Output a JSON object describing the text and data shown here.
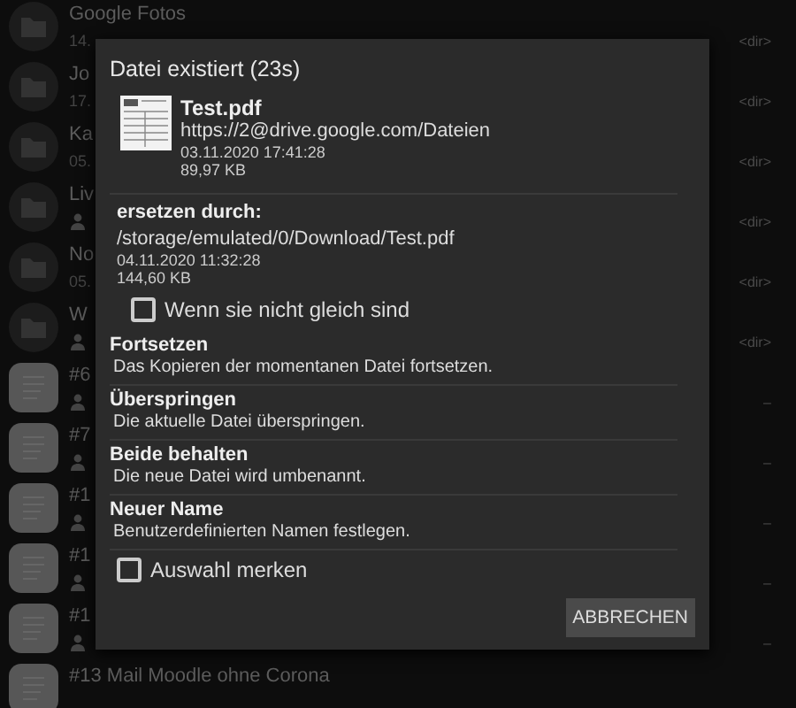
{
  "background_list": [
    {
      "kind": "folder",
      "name": "Google Fotos",
      "detail": "14.",
      "shared": false,
      "info": "<dir>"
    },
    {
      "kind": "folder",
      "name": "Jo",
      "detail": "17.",
      "shared": false,
      "info": "<dir>"
    },
    {
      "kind": "folder",
      "name": "Ka",
      "detail": "05.",
      "shared": false,
      "info": "<dir>"
    },
    {
      "kind": "folder",
      "name": "Liv",
      "shared": true,
      "info": "<dir>"
    },
    {
      "kind": "folder",
      "name": "No",
      "detail": "05.",
      "shared": false,
      "info": "<dir>"
    },
    {
      "kind": "folder",
      "name": "W",
      "shared": true,
      "info": "<dir>"
    },
    {
      "kind": "document",
      "name": "#6",
      "shared": true,
      "info": "–"
    },
    {
      "kind": "document",
      "name": "#7",
      "shared": true,
      "info": "–"
    },
    {
      "kind": "document",
      "name": "#1",
      "shared": true,
      "info": "–"
    },
    {
      "kind": "document",
      "name": "#1",
      "shared": true,
      "info": "–"
    },
    {
      "kind": "document",
      "name": "#1",
      "shared": true,
      "info": "–"
    },
    {
      "kind": "document",
      "name": "#13 Mail Moodle ohne Corona",
      "shared": false
    }
  ],
  "dialog": {
    "title": "Datei existiert (23s)",
    "existing_file": {
      "name": "Test.pdf",
      "location": "https://2@drive.google.com/Dateien",
      "date": "03.11.2020 17:41:28",
      "size": "89,97 KB"
    },
    "replace_label": "ersetzen durch:",
    "new_file": {
      "location": "/storage/emulated/0/Download/Test.pdf",
      "date": "04.11.2020 11:32:28",
      "size": "144,60 KB"
    },
    "only_if_different": {
      "label": "Wenn sie nicht gleich sind",
      "checked": false
    },
    "options": [
      {
        "title": "Fortsetzen",
        "description": "Das Kopieren der momentanen Datei fortsetzen."
      },
      {
        "title": "Überspringen",
        "description": "Die aktuelle Datei überspringen."
      },
      {
        "title": "Beide behalten",
        "description": "Die neue Datei wird umbenannt."
      },
      {
        "title": "Neuer Name",
        "description": "Benutzerdefinierten Namen festlegen."
      }
    ],
    "remember": {
      "label": "Auswahl merken",
      "checked": false
    },
    "buttons": [
      "ABBRECHEN"
    ]
  }
}
